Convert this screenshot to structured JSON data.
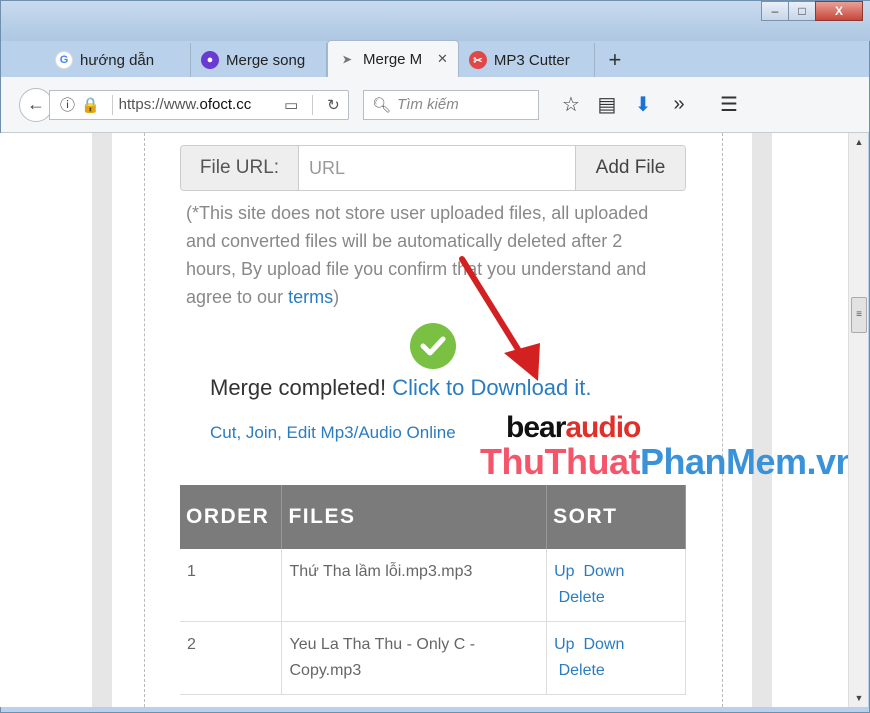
{
  "window": {
    "controls": {
      "minimize": "–",
      "maximize": "□",
      "close": "X"
    }
  },
  "tabs": [
    {
      "label": "hướng dẫn",
      "icon": "google-icon",
      "active": false
    },
    {
      "label": "Merge song",
      "icon": "opera-icon",
      "active": false
    },
    {
      "label": "Merge M",
      "icon": "bird-icon",
      "active": true
    },
    {
      "label": "MP3 Cutter",
      "icon": "mp3cutter-icon",
      "active": false
    }
  ],
  "new_tab_label": "+",
  "nav": {
    "url_prefix": "https://www.",
    "url_domain": "ofoct.cc",
    "search_placeholder": "Tìm kiếm"
  },
  "page": {
    "file_url_label": "File URL:",
    "file_url_placeholder": "URL",
    "add_file_label": "Add File",
    "notice_text": "(*This site does not store user uploaded files, all uploaded and converted files will be automatically deleted after 2 hours, By upload file you confirm that you understand and agree to our ",
    "notice_link": "terms",
    "notice_end": ")",
    "completed_text": "Merge completed! ",
    "download_link": "Click to Download it.",
    "cut_join_link": "Cut, Join, Edit Mp3/Audio Online",
    "logo_part1": "bear",
    "logo_part2": "audio",
    "watermark_part1": "ThuThuat",
    "watermark_part2": "PhanMem.vn"
  },
  "table": {
    "headers": [
      "ORDER",
      "FILES",
      "SORT"
    ],
    "rows": [
      {
        "order": "1",
        "file": "Thứ Tha lầm lỗi.mp3.mp3",
        "up": "Up",
        "down": "Down",
        "delete": "Delete"
      },
      {
        "order": "2",
        "file": "Yeu La Tha Thu - Only C - Copy.mp3",
        "up": "Up",
        "down": "Down",
        "delete": "Delete"
      }
    ]
  },
  "colors": {
    "accent_link": "#2a7cc1",
    "success": "#79c043",
    "table_header": "#7b7b7b",
    "annotation_arrow": "#d32020"
  }
}
